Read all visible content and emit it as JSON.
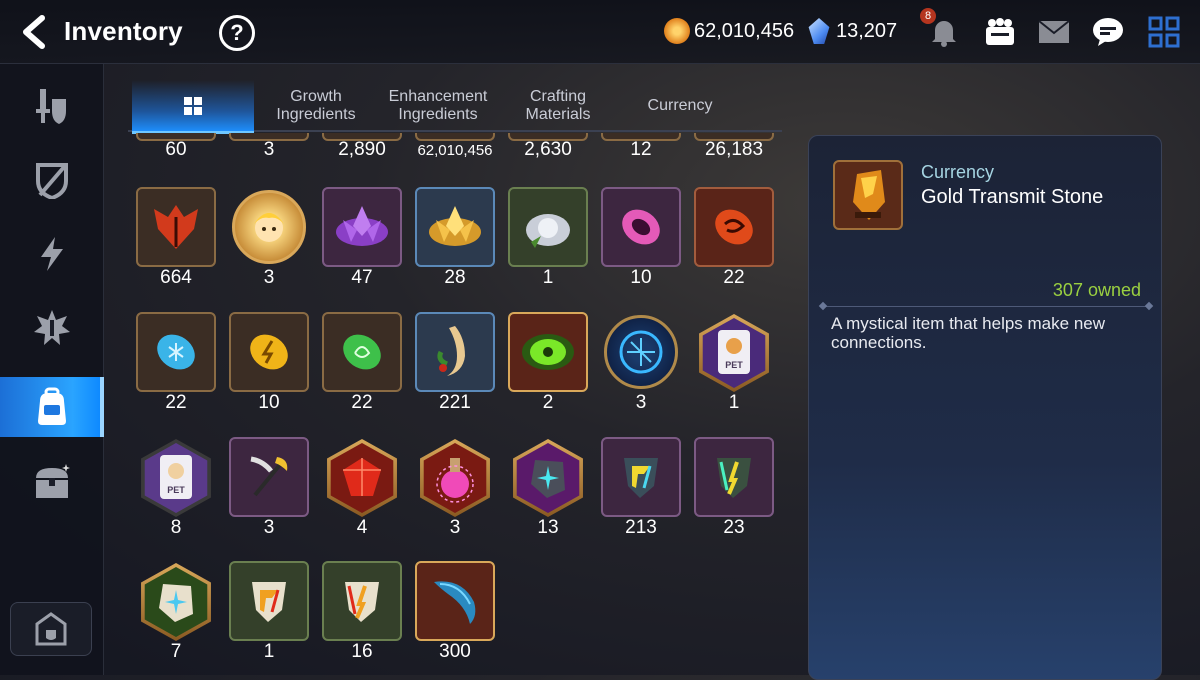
{
  "header": {
    "title": "Inventory",
    "help_label": "?",
    "gold": "62,010,456",
    "crystals": "13,207",
    "notification_count": "8"
  },
  "tabs": [
    {
      "label": "",
      "active": true
    },
    {
      "label": "Growth\nIngredients"
    },
    {
      "label": "Enhancement\nIngredients"
    },
    {
      "label": "Crafting\nMaterials"
    },
    {
      "label": "Currency"
    }
  ],
  "sidebar": {
    "items": [
      "equipment-icon",
      "shield-icon",
      "lightning-icon",
      "artifact-icon",
      "bag-icon",
      "chest-icon"
    ],
    "active_index": 4
  },
  "grid": {
    "row0": [
      "60",
      "3",
      "2,890",
      "62,010,456",
      "2,630",
      "12",
      "26,183"
    ],
    "rows": [
      [
        "664",
        "3",
        "47",
        "28",
        "1",
        "10",
        "22"
      ],
      [
        "22",
        "10",
        "22",
        "221",
        "2",
        "3",
        "1"
      ],
      [
        "8",
        "3",
        "4",
        "3",
        "13",
        "213",
        "23"
      ],
      [
        "7",
        "1",
        "16",
        "300"
      ]
    ]
  },
  "detail": {
    "category": "Currency",
    "name": "Gold Transmit Stone",
    "owned": "307 owned",
    "description": "A mystical item that helps make new connections."
  },
  "colors": {
    "accent": "#1e90ff",
    "owned": "#9ad040"
  }
}
